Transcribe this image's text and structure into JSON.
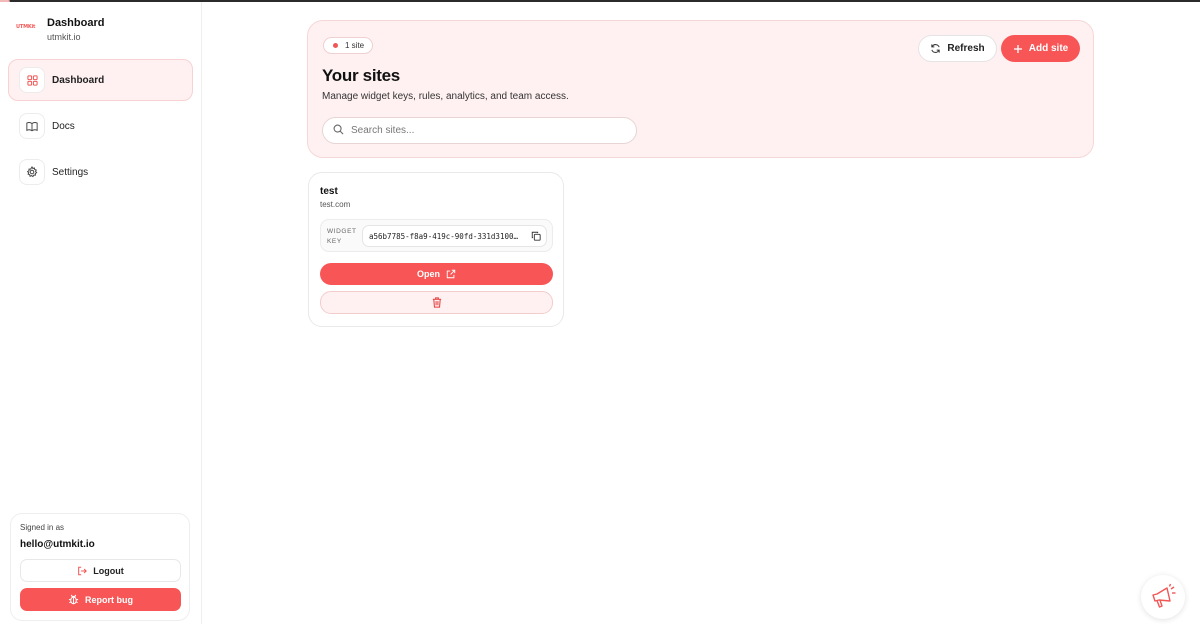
{
  "brand": {
    "logo_text": "UTMKit",
    "title": "Dashboard",
    "subtitle": "utmkit.io"
  },
  "sidebar": {
    "items": [
      {
        "label": "Dashboard",
        "icon": "grid-icon",
        "active": true
      },
      {
        "label": "Docs",
        "icon": "book-icon",
        "active": false
      },
      {
        "label": "Settings",
        "icon": "gear-icon",
        "active": false
      }
    ]
  },
  "user": {
    "signed_in_label": "Signed in as",
    "email": "hello@utmkit.io",
    "logout_label": "Logout",
    "report_bug_label": "Report bug"
  },
  "hero": {
    "pill_label": "1 site",
    "title": "Your sites",
    "subtitle": "Manage widget keys, rules, analytics, and team access.",
    "search_placeholder": "Search sites...",
    "refresh_label": "Refresh",
    "add_site_label": "Add site"
  },
  "sites": [
    {
      "name": "test",
      "domain": "test.com",
      "widget_key_label_line1": "WIDGET",
      "widget_key_label_line2": "KEY",
      "widget_key": "a56b7785-f8a9-419c-90fd-331d3100…",
      "open_label": "Open"
    }
  ],
  "colors": {
    "accent": "#f85656",
    "accent_soft": "#fff1f1"
  }
}
